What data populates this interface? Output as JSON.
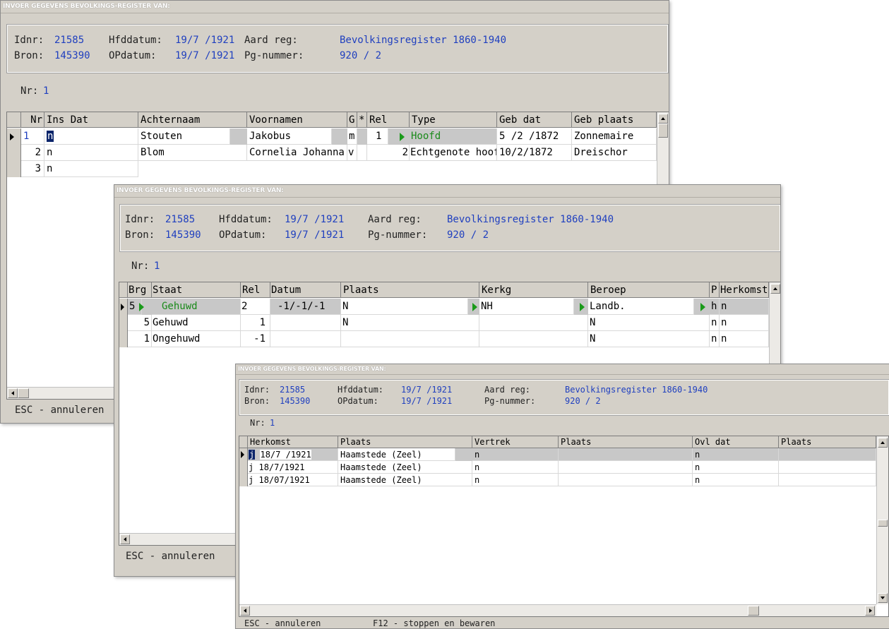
{
  "window_title": "INVOER GEGEVENS BEVOLKINGS-REGISTER VAN:",
  "info": {
    "idnr_label": "Idnr:",
    "idnr": "21585",
    "bron_label": "Bron:",
    "bron": "145390",
    "hfddatum_label": "Hfddatum:",
    "hfddatum": "19/7 /1921",
    "opdatum_label": "OPdatum:",
    "opdatum": "19/7 /1921",
    "aard_label": "Aard reg:",
    "aard": "Bevolkingsregister 1860-1940",
    "pg_label": "Pg-nummer:",
    "pg": "920 / 2"
  },
  "nr_label": "Nr:",
  "nr_value": "1",
  "status": {
    "esc": "ESC - annuleren",
    "f12": "F12 - stoppen en bewaren"
  },
  "window1": {
    "headers": [
      "Nr",
      "Ins Dat",
      "Achternaam",
      "Voornamen",
      "G",
      "*",
      "Rel",
      "Type",
      "Geb dat",
      "Geb plaats"
    ],
    "rows": [
      {
        "nr": "1",
        "insdat": "n",
        "achternaam": "Stouten",
        "voornamen": "Jakobus",
        "g": "m",
        "ster": "",
        "rel": "1",
        "type": "Hoofd",
        "gebdat": "5 /2 /1872",
        "gebplaats": "Zonnemaire"
      },
      {
        "nr": "2",
        "insdat": "n",
        "achternaam": "Blom",
        "voornamen": "Cornelia Johanna",
        "g": "v",
        "ster": "",
        "rel": "2",
        "type": "Echtgenote hoofd",
        "gebdat": "10/2/1872",
        "gebplaats": "Dreischor"
      },
      {
        "nr": "3",
        "insdat": "n",
        "achternaam": "",
        "voornamen": "",
        "g": "",
        "ster": "",
        "rel": "",
        "type": "",
        "gebdat": "",
        "gebplaats": ""
      }
    ]
  },
  "window2": {
    "headers": [
      "Brg",
      "Staat",
      "Rel",
      "Datum",
      "Plaats",
      "Kerkg",
      "Beroep",
      "P",
      "Herkomst"
    ],
    "rows": [
      {
        "brg": "5",
        "staat": "Gehuwd",
        "rel": "2",
        "datum": "-1/-1/-1",
        "plaats": "N",
        "kerkg": "NH",
        "beroep": "Landb.",
        "p": "h",
        "herkomst": "n"
      },
      {
        "brg": "5",
        "staat": "Gehuwd",
        "rel": "1",
        "datum": "",
        "plaats": "N",
        "kerkg": "",
        "beroep": "N",
        "p": "n",
        "herkomst": "n"
      },
      {
        "brg": "1",
        "staat": "Ongehuwd",
        "rel": "-1",
        "datum": "",
        "plaats": "",
        "kerkg": "",
        "beroep": "N",
        "p": "n",
        "herkomst": "n"
      }
    ]
  },
  "window3": {
    "headers": [
      "Herkomst",
      "Plaats",
      "Vertrek",
      "Plaats",
      "Ovl dat",
      "Plaats"
    ],
    "rows": [
      {
        "herkomst_flag": "j",
        "herkomst_date": "18/7 /1921",
        "plaats": "Haamstede (Zeel)",
        "vertrek": "n",
        "plaats2": "",
        "ovldat": "n",
        "plaats3": ""
      },
      {
        "herkomst_flag": "j",
        "herkomst_date": "18/7/1921",
        "plaats": "Haamstede (Zeel)",
        "vertrek": "n",
        "plaats2": "",
        "ovldat": "n",
        "plaats3": ""
      },
      {
        "herkomst_flag": "j",
        "herkomst_date": "18/07/1921",
        "plaats": "Haamstede (Zeel)",
        "vertrek": "n",
        "plaats2": "",
        "ovldat": "n",
        "plaats3": ""
      }
    ]
  }
}
